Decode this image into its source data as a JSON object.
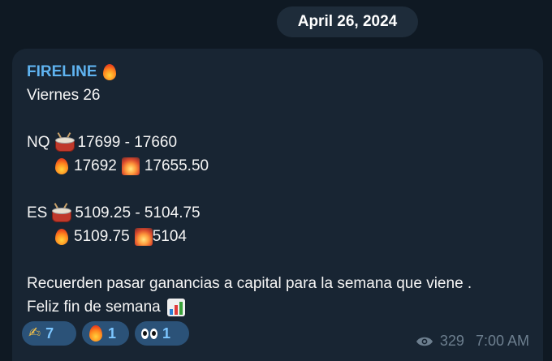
{
  "date_pill": "April 26, 2024",
  "message": {
    "sender": "FIRELINE",
    "sender_icon": "fire-emoji",
    "lines": {
      "day": "Viernes 26",
      "nq_label": "NQ",
      "nq_range": "17699 - 17660",
      "nq_fire": "17692",
      "nq_spark": "17655.50",
      "es_label": "ES",
      "es_range": "5109.25 - 5104.75",
      "es_fire": "5109.75",
      "es_spark": "5104",
      "closing_1": "Recuerden pasar ganancias a capital para la semana que viene .",
      "closing_2": "Feliz fin de semana"
    },
    "reactions": [
      {
        "icon": "writing-hand-emoji",
        "count": "7"
      },
      {
        "icon": "fire-emoji",
        "count": "1"
      },
      {
        "icon": "eyes-emoji",
        "count": "1"
      }
    ],
    "views": "329",
    "time": "7:00 AM"
  },
  "colors": {
    "background": "#0f1923",
    "bubble": "#182533",
    "sender": "#5fb3f0",
    "reaction_bg": "#2b5278",
    "reaction_text": "#7cc6ff",
    "meta": "#6d7f8f"
  }
}
